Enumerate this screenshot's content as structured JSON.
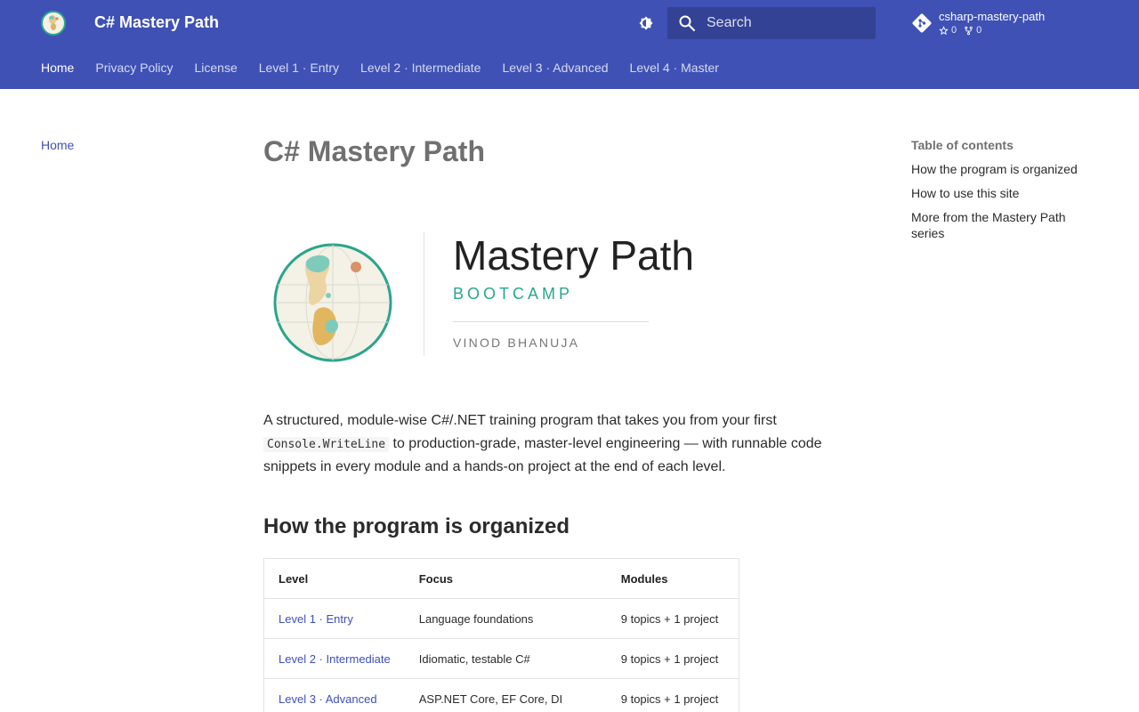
{
  "colors": {
    "primary": "#3f51b5",
    "accent": "#2aa58c"
  },
  "header": {
    "logo_icon": "mastery-path-logo-icon",
    "site_title": "C# Mastery Path",
    "theme_toggle_icon": "brightness-icon",
    "search": {
      "placeholder": "Search",
      "icon": "search-icon"
    },
    "repo": {
      "icon": "git-icon",
      "name": "csharp-mastery-path",
      "stars": "0",
      "forks": "0"
    },
    "tabs": [
      {
        "label": "Home",
        "active": true
      },
      {
        "label": "Privacy Policy"
      },
      {
        "label": "License"
      },
      {
        "label": "Level 1 · Entry"
      },
      {
        "label": "Level 2 · Intermediate"
      },
      {
        "label": "Level 3 · Advanced"
      },
      {
        "label": "Level 4 · Master"
      }
    ]
  },
  "sidebar": {
    "items": [
      {
        "label": "Home"
      }
    ]
  },
  "toc": {
    "title": "Table of contents",
    "items": [
      {
        "label": "How the program is organized"
      },
      {
        "label": "How to use this site"
      },
      {
        "label": "More from the Mastery Path series"
      }
    ]
  },
  "main": {
    "title": "C# Mastery Path",
    "hero": {
      "title": "Mastery Path",
      "subtitle": "BOOTCAMP",
      "author": "VINOD BHANUJA"
    },
    "intro": {
      "before": "A structured, module-wise C#/.NET training program that takes you from your first ",
      "code": "Console.WriteLine",
      "after": " to production-grade, master-level engineering — with runnable code snippets in every module and a hands-on project at the end of each level."
    },
    "section_heading": "How the program is organized",
    "table": {
      "headers": [
        "Level",
        "Focus",
        "Modules"
      ],
      "rows": [
        {
          "level": "Level 1 · Entry",
          "focus": "Language foundations",
          "modules": "9 topics + 1 project"
        },
        {
          "level": "Level 2 · Intermediate",
          "focus": "Idiomatic, testable C#",
          "modules": "9 topics + 1 project"
        },
        {
          "level": "Level 3 · Advanced",
          "focus": "ASP.NET Core, EF Core, DI",
          "modules": "9 topics + 1 project"
        }
      ]
    }
  }
}
